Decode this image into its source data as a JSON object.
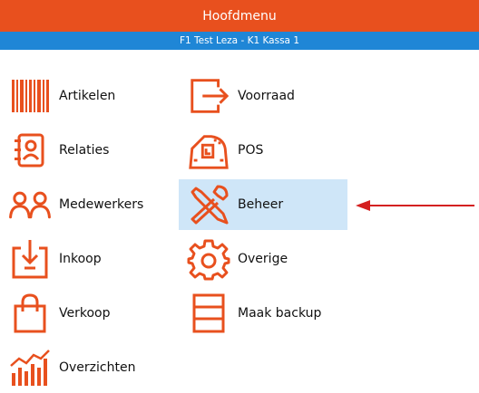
{
  "window": {
    "title": "Hoofdmenu",
    "subtitle": "F1 Test Leza - K1 Kassa 1"
  },
  "colors": {
    "title_bar": "#e8501e",
    "sub_bar": "#1f86d6",
    "icon": "#e8501e",
    "selected_bg": "#cfe6f8",
    "pointer_arrow": "#d42020"
  },
  "menu": {
    "left": [
      {
        "label": "Artikelen",
        "icon": "barcode-icon"
      },
      {
        "label": "Relaties",
        "icon": "contact-book-icon"
      },
      {
        "label": "Medewerkers",
        "icon": "people-icon"
      },
      {
        "label": "Inkoop",
        "icon": "inbox-download-icon"
      },
      {
        "label": "Verkoop",
        "icon": "shopping-bag-icon"
      },
      {
        "label": "Overzichten",
        "icon": "chart-icon"
      }
    ],
    "right": [
      {
        "label": "Voorraad",
        "icon": "stock-export-icon"
      },
      {
        "label": "POS",
        "icon": "cash-register-icon"
      },
      {
        "label": "Beheer",
        "icon": "tools-icon",
        "selected": true
      },
      {
        "label": "Overige",
        "icon": "gear-icon"
      },
      {
        "label": "Maak backup",
        "icon": "backup-icon"
      }
    ]
  }
}
